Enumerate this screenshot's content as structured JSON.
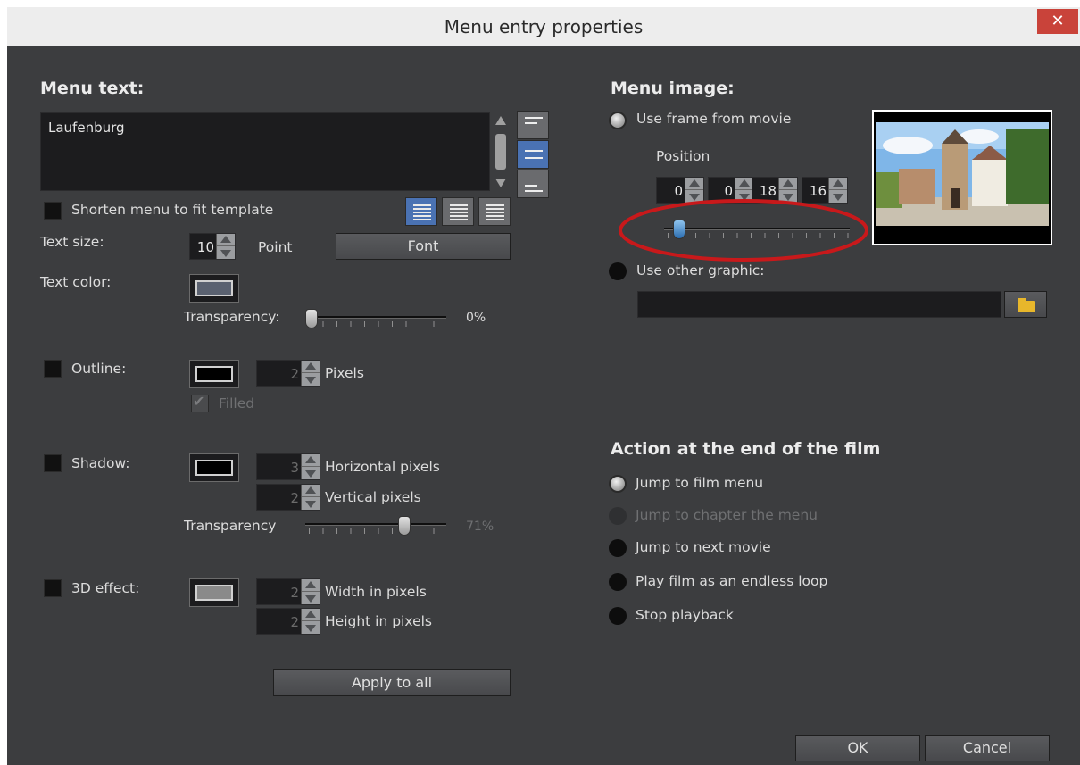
{
  "window": {
    "title": "Menu entry properties",
    "close_label": "✕"
  },
  "menu_text": {
    "heading": "Menu text:",
    "value": "Laufenburg",
    "shorten_label": "Shorten menu to fit template",
    "text_size_label": "Text size:",
    "text_size_value": "10",
    "text_size_unit": "Point",
    "font_button": "Font",
    "text_color_label": "Text color:",
    "transparency_label": "Transparency:",
    "transparency_value": "0%",
    "transparency_level": 0
  },
  "outline": {
    "label": "Outline:",
    "value": "2",
    "unit": "Pixels",
    "filled_label": "Filled"
  },
  "shadow": {
    "label": "Shadow:",
    "horizontal_value": "3",
    "horizontal_label": "Horizontal pixels",
    "vertical_value": "2",
    "vertical_label": "Vertical pixels",
    "transparency_label": "Transparency",
    "transparency_value": "71%",
    "transparency_level": 0.71
  },
  "effect3d": {
    "label": "3D effect:",
    "width_value": "2",
    "width_label": "Width in pixels",
    "height_value": "2",
    "height_label": "Height in pixels"
  },
  "apply_all_button": "Apply to all",
  "menu_image": {
    "heading": "Menu image:",
    "use_frame_label": "Use frame from movie",
    "position_label": "Position",
    "position_fields": [
      "0",
      "0",
      "18",
      "16"
    ],
    "use_other_label": "Use other graphic:",
    "graphic_path": ""
  },
  "action": {
    "heading": "Action at the end of the film",
    "options": [
      {
        "label": "Jump to film menu",
        "state": "selected"
      },
      {
        "label": "Jump to chapter the menu",
        "state": "disabled"
      },
      {
        "label": "Jump to next movie",
        "state": "normal"
      },
      {
        "label": "Play film as an endless loop",
        "state": "normal"
      },
      {
        "label": "Stop playback",
        "state": "normal"
      }
    ]
  },
  "footer": {
    "ok_button": "OK",
    "cancel_button": "Cancel"
  },
  "colors": {
    "highlight_circle": "#c8191b",
    "accent_blue": "#4a72b3"
  }
}
